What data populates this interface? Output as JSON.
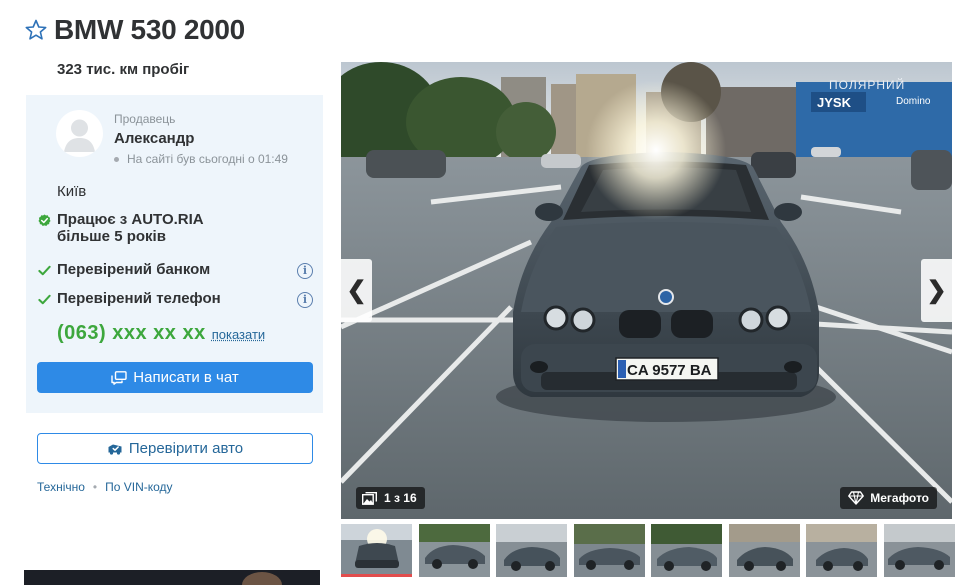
{
  "listing": {
    "title": "BMW 530 2000",
    "mileage": "323 тис. км пробіг"
  },
  "seller": {
    "role_label": "Продавець",
    "name": "Александр",
    "last_seen": "На сайті був сьогодні о 01:49",
    "city": "Київ",
    "badge_auto_line1": "Працює з AUTO.RIA",
    "badge_auto_line2": "більше 5 років",
    "verified_bank": "Перевірений банком",
    "verified_phone": "Перевірений телефон",
    "info_icon_glyph": "i",
    "phone_masked": "(063) xxx xx xx",
    "show_phone_link": "показати",
    "chat_button": "Написати в чат"
  },
  "actions": {
    "check_car_button": "Перевірити авто",
    "technical_link": "Технічно",
    "separator": "•",
    "vin_link": "По VIN-коду"
  },
  "gallery": {
    "prev_arrow": "❮",
    "next_arrow": "❯",
    "counter": "1 з 16",
    "mega_photo": "Мегафото",
    "plate": "CA 9577 BA",
    "sign_store": "JYSK",
    "sign_mall": "ПОЛЯРНИЙ",
    "sign_extra": "Domino",
    "thumbnails_count": 8,
    "active_thumbnail": 1
  },
  "colors": {
    "accent_blue": "#2e8ae6",
    "link_blue": "#256799",
    "phone_green": "#3da73d",
    "verified_green": "#3da73d",
    "card_bg": "#eef5fb",
    "active_thumb_bar": "#e24d4d"
  },
  "icons": {
    "favorite": "star-outline-icon",
    "verified": "check-icon",
    "info": "info-circle-icon",
    "chat": "chat-icon",
    "check_car": "car-check-icon",
    "gallery_counter": "photos-icon",
    "mega_photo": "diamond-icon"
  }
}
